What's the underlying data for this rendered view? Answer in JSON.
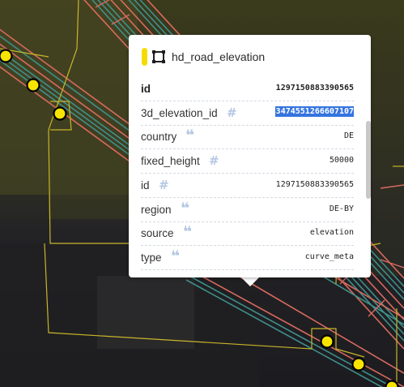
{
  "popup": {
    "layer_name": "hd_road_elevation",
    "layer_color": "#f5dc00",
    "properties": [
      {
        "key": "id",
        "icon": "",
        "value": "1297150883390565",
        "bold_key": true,
        "selected": false
      },
      {
        "key": "3d_elevation_id",
        "icon": "number-icon",
        "value": "3474551266607107",
        "bold_key": false,
        "selected": true
      },
      {
        "key": "country",
        "icon": "quote-icon",
        "value": "DE",
        "bold_key": false,
        "selected": false
      },
      {
        "key": "fixed_height",
        "icon": "number-icon",
        "value": "50000",
        "bold_key": false,
        "selected": false
      },
      {
        "key": "id",
        "icon": "number-icon",
        "value": "1297150883390565",
        "bold_key": false,
        "selected": false
      },
      {
        "key": "region",
        "icon": "quote-icon",
        "value": "DE-BY",
        "bold_key": false,
        "selected": false
      },
      {
        "key": "source",
        "icon": "quote-icon",
        "value": "elevation",
        "bold_key": false,
        "selected": false
      },
      {
        "key": "type",
        "icon": "quote-icon",
        "value": "curve_meta",
        "bold_key": false,
        "selected": false
      }
    ]
  },
  "icons": {
    "number": "#",
    "quote": "❝"
  },
  "colors": {
    "road_red": "#d96a5e",
    "road_teal": "#3f8f8b",
    "boundary_yellow": "#c9b52a",
    "marker_yellow": "#f7e400"
  }
}
